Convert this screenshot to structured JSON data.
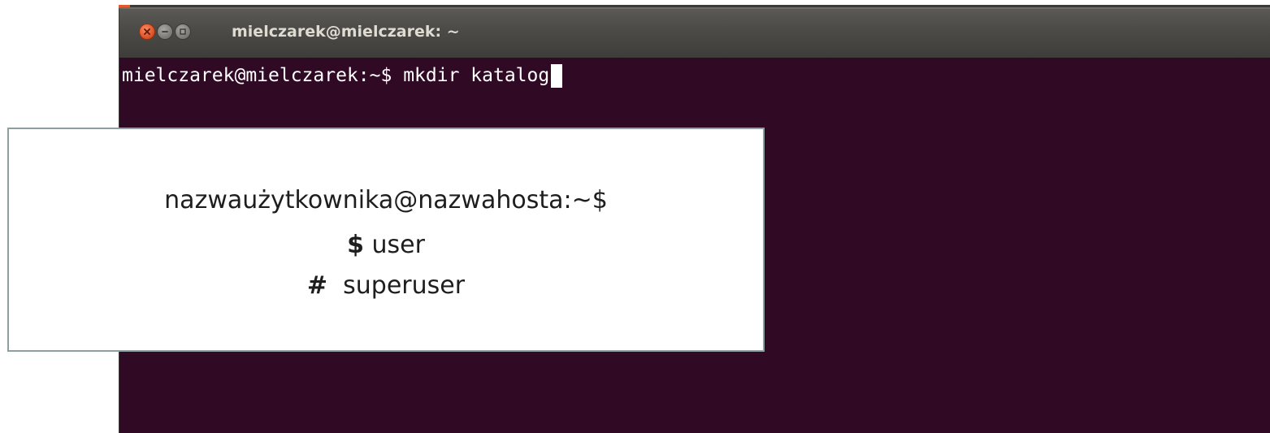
{
  "window": {
    "title": "mielczarek@mielczarek: ~",
    "buttons": {
      "close": "close-icon",
      "minimize": "minimize-icon",
      "maximize": "maximize-icon"
    },
    "colors": {
      "titlebar": "#4b4a46",
      "close_button": "#e4582c",
      "terminal_background": "#300a24",
      "terminal_text": "#ffffff"
    }
  },
  "terminal": {
    "prompt": "mielczarek@mielczarek:~$",
    "command": "mkdir katalog"
  },
  "note": {
    "line1": "nazwaużytkownika@nazwahosta:~$",
    "line2_symbol": "$",
    "line2_text": "user",
    "line3_symbol": "#",
    "line3_text": "superuser",
    "border_color": "#8e9ea1"
  }
}
